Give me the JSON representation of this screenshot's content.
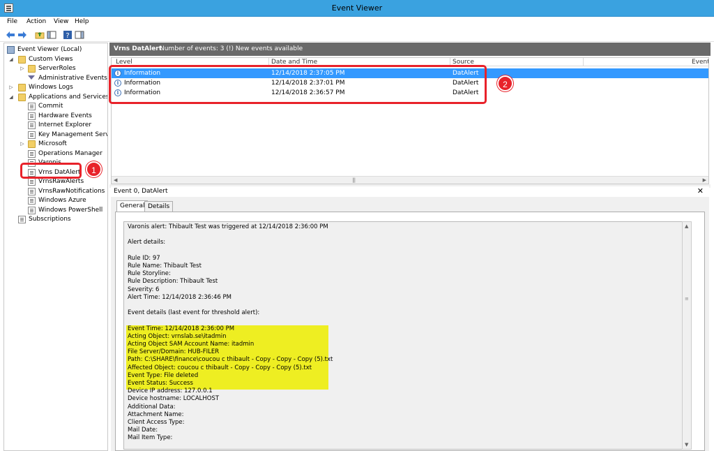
{
  "window": {
    "title": "Event Viewer"
  },
  "menu": [
    "File",
    "Action",
    "View",
    "Help"
  ],
  "tree": [
    {
      "label": "Event Viewer (Local)",
      "level": 0,
      "icon": "root-icon",
      "expander": ""
    },
    {
      "label": "Custom Views",
      "level": 1,
      "icon": "folder-icon",
      "expander": "◢"
    },
    {
      "label": "ServerRoles",
      "level": 2,
      "icon": "folder-icon",
      "expander": "▷"
    },
    {
      "label": "Administrative Events",
      "level": 2,
      "icon": "filter-icon",
      "expander": ""
    },
    {
      "label": "Windows Logs",
      "level": 1,
      "icon": "folder-icon",
      "expander": "▷"
    },
    {
      "label": "Applications and Services Lo",
      "level": 1,
      "icon": "folder-icon",
      "expander": "◢"
    },
    {
      "label": "Commit",
      "level": 2,
      "icon": "log-icon",
      "expander": ""
    },
    {
      "label": "Hardware Events",
      "level": 2,
      "icon": "log-icon",
      "expander": ""
    },
    {
      "label": "Internet Explorer",
      "level": 2,
      "icon": "log-icon",
      "expander": ""
    },
    {
      "label": "Key Management Service",
      "level": 2,
      "icon": "log-icon",
      "expander": ""
    },
    {
      "label": "Microsoft",
      "level": 2,
      "icon": "folder-icon",
      "expander": "▷"
    },
    {
      "label": "Operations Manager",
      "level": 2,
      "icon": "log-icon",
      "expander": ""
    },
    {
      "label": "Varonis",
      "level": 2,
      "icon": "log-icon",
      "expander": ""
    },
    {
      "label": "Vrns DatAlert",
      "level": 2,
      "icon": "log-icon",
      "expander": ""
    },
    {
      "label": "VrnsRawAlerts",
      "level": 2,
      "icon": "log-icon",
      "expander": ""
    },
    {
      "label": "VrnsRawNotifications",
      "level": 2,
      "icon": "log-icon",
      "expander": ""
    },
    {
      "label": "Windows Azure",
      "level": 2,
      "icon": "log-icon",
      "expander": ""
    },
    {
      "label": "Windows PowerShell",
      "level": 2,
      "icon": "log-icon",
      "expander": ""
    },
    {
      "label": "Subscriptions",
      "level": 1,
      "icon": "log-icon",
      "expander": ""
    }
  ],
  "content": {
    "log_name": "Vrns DatAlert",
    "event_count": "Number of events: 3 (!) New events available",
    "columns": [
      "Level",
      "Date and Time",
      "Source",
      "Event"
    ],
    "events": [
      {
        "level": "Information",
        "datetime": "12/14/2018 2:37:05 PM",
        "source": "DatAlert",
        "selected": true
      },
      {
        "level": "Information",
        "datetime": "12/14/2018 2:37:01 PM",
        "source": "DatAlert",
        "selected": false
      },
      {
        "level": "Information",
        "datetime": "12/14/2018 2:36:57 PM",
        "source": "DatAlert",
        "selected": false
      }
    ],
    "detail_title": "Event 0, DatAlert",
    "close_glyph": "✕",
    "tabs": [
      "General",
      "Details"
    ],
    "detail_lines": [
      "Varonis alert: Thibault Test was triggered at 12/14/2018 2:36:00 PM",
      "",
      "Alert details:",
      "",
      "Rule ID: 97",
      "Rule Name: Thibault Test",
      "Rule Storyline:",
      "Rule Description: Thibault Test",
      "Severity: 6",
      "Alert Time: 12/14/2018 2:36:46 PM",
      "",
      "Event details (last event for threshold alert):",
      "",
      "Event Time: 12/14/2018 2:36:00 PM",
      "Acting Object: vrnslab.se\\itadmin",
      "Acting Object SAM Account Name: itadmin",
      "File Server/Domain: HUB-FILER",
      "Path: C:\\SHARE\\finance\\coucou c thibault - Copy - Copy - Copy (5).txt",
      "Affected Object: coucou c thibault - Copy - Copy - Copy (5).txt",
      "Event Type: File deleted",
      "Event Status: Success",
      "Device IP address: 127.0.0.1",
      "Device hostname: LOCALHOST",
      "Additional Data:",
      "Attachment Name:",
      "Client Access Type:",
      "Mail Date:",
      "Mail Item Type:"
    ]
  },
  "callouts": [
    "1",
    "2"
  ]
}
